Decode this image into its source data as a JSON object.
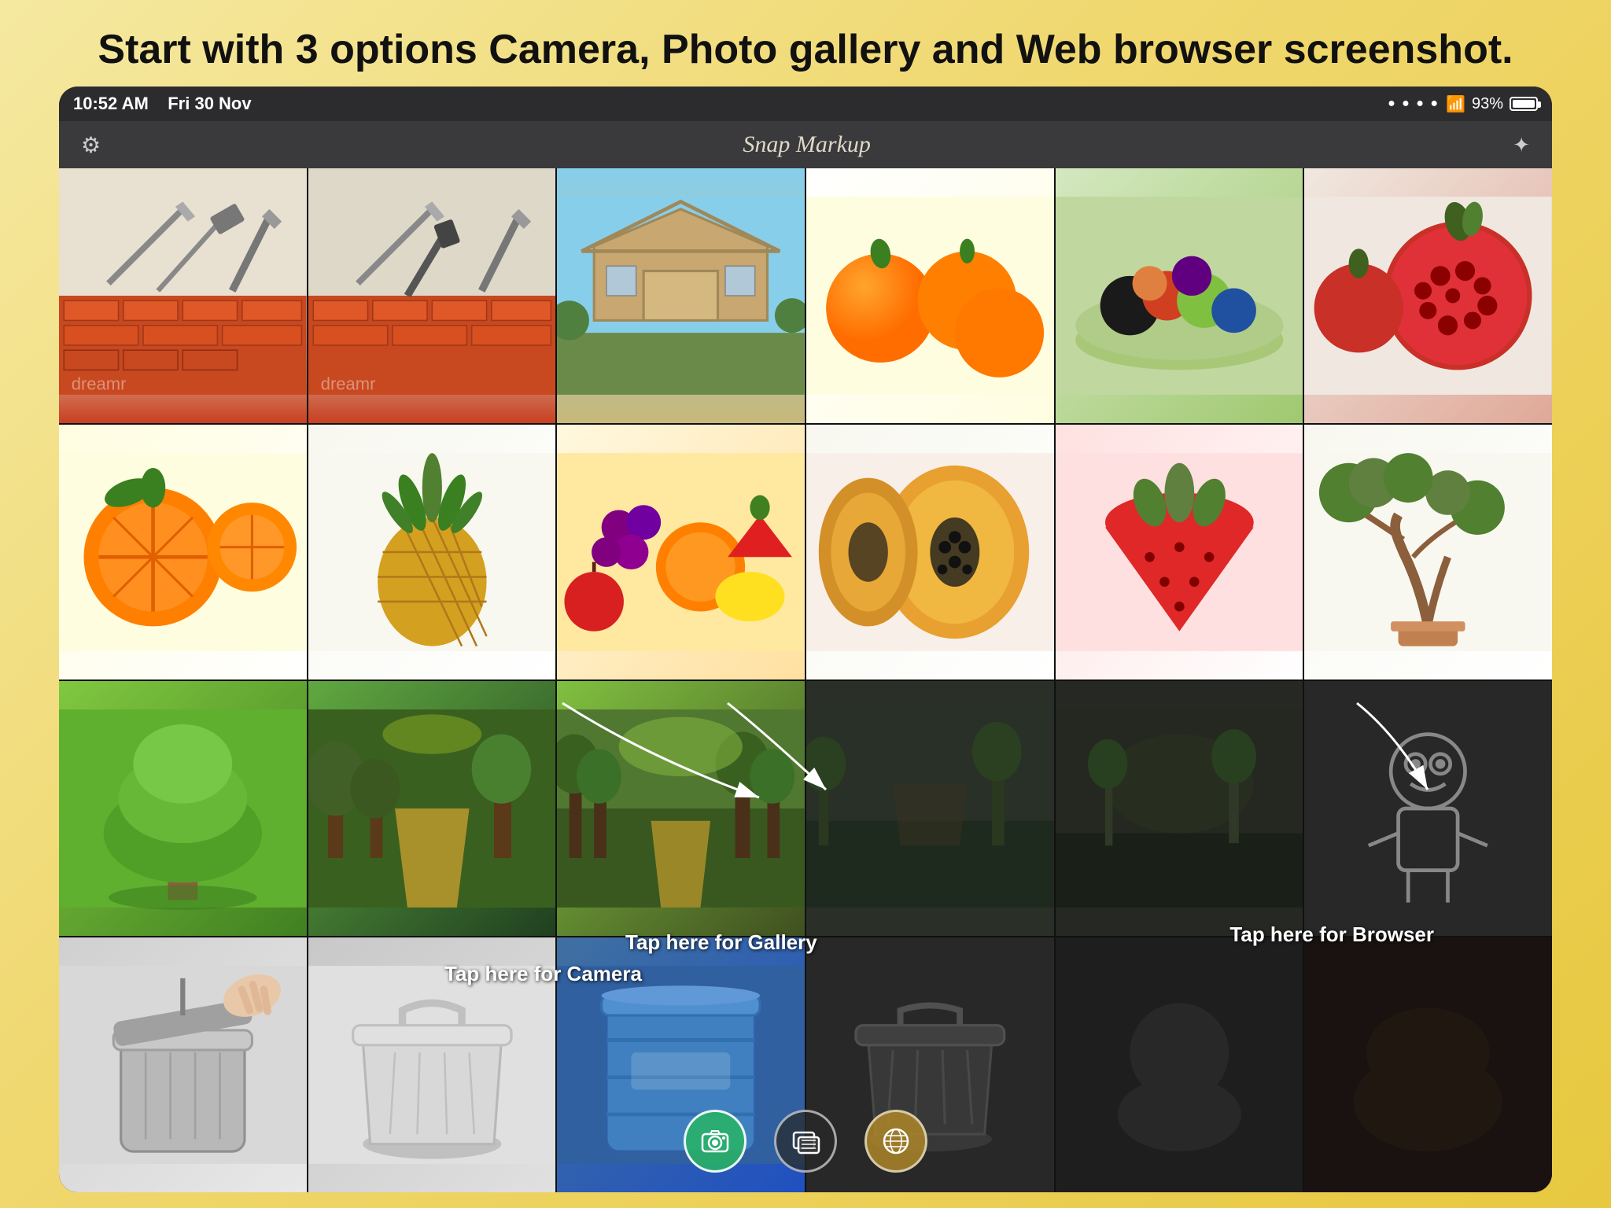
{
  "page": {
    "title": "Start with 3 options Camera, Photo gallery and Web browser screenshot."
  },
  "status_bar": {
    "time": "10:52 AM",
    "date": "Fri 30 Nov",
    "battery": "93%",
    "signal": "●●●●"
  },
  "nav": {
    "title": "Snap Markup",
    "settings_icon": "⚙",
    "store_icon": "✦"
  },
  "annotations": {
    "camera_label": "Tap here for\nCamera",
    "gallery_label": "Tap here for\nGallery",
    "browser_label": "Tap here for\nBrowser"
  },
  "toolbar": {
    "camera_label": "📷",
    "gallery_label": "⊡",
    "browser_label": "🌐"
  },
  "photos": [
    {
      "id": 1,
      "type": "bricks-tools",
      "emoji": "🧱"
    },
    {
      "id": 2,
      "type": "bricks-tools2",
      "emoji": "🧱"
    },
    {
      "id": 3,
      "type": "house-construction",
      "emoji": "🏗️"
    },
    {
      "id": 4,
      "type": "oranges",
      "emoji": "🍊"
    },
    {
      "id": 5,
      "type": "fruit-bowl",
      "emoji": "🍇"
    },
    {
      "id": 6,
      "type": "pomegranate",
      "emoji": "🍎"
    },
    {
      "id": 7,
      "type": "orange-slices",
      "emoji": "🍊"
    },
    {
      "id": 8,
      "type": "pineapple",
      "emoji": "🍍"
    },
    {
      "id": 9,
      "type": "mixed-fruits",
      "emoji": "🍇"
    },
    {
      "id": 10,
      "type": "papaya",
      "emoji": "🥭"
    },
    {
      "id": 11,
      "type": "strawberry",
      "emoji": "🍓"
    },
    {
      "id": 12,
      "type": "bonsai-tree",
      "emoji": "🌳"
    },
    {
      "id": 13,
      "type": "green-tree",
      "emoji": "🌲"
    },
    {
      "id": 14,
      "type": "forest-path",
      "emoji": "🌳"
    },
    {
      "id": 15,
      "type": "forest-trees",
      "emoji": "🌿"
    },
    {
      "id": 16,
      "type": "dark-park",
      "emoji": "🏞️"
    },
    {
      "id": 17,
      "type": "dark-park2",
      "emoji": "🏞️"
    },
    {
      "id": 18,
      "type": "cartoon-character",
      "emoji": "🎭"
    },
    {
      "id": 19,
      "type": "smart-trash",
      "emoji": "🗑️"
    },
    {
      "id": 20,
      "type": "white-trash",
      "emoji": "🗑️"
    },
    {
      "id": 21,
      "type": "blue-container",
      "emoji": "🪣"
    },
    {
      "id": 22,
      "type": "trash-icon-dark",
      "emoji": "🗑️"
    },
    {
      "id": 23,
      "type": "dark-img5",
      "emoji": ""
    },
    {
      "id": 24,
      "type": "dark-img6",
      "emoji": ""
    }
  ]
}
